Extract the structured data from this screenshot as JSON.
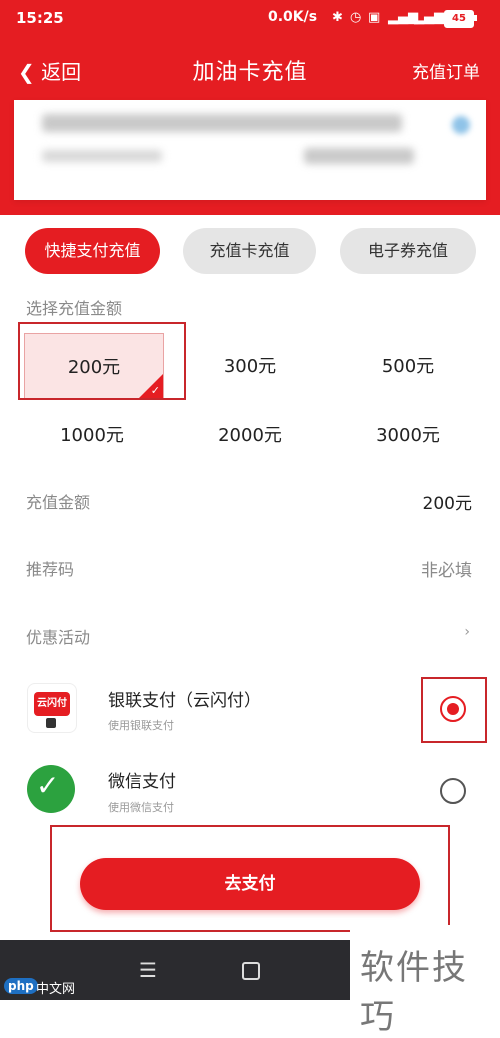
{
  "status_bar": {
    "time": "15:25",
    "net_speed": "0.0K/s",
    "battery": "45"
  },
  "nav": {
    "back": "返回",
    "title": "加油卡充值",
    "orders": "充值订单"
  },
  "tabs": [
    "快捷支付充值",
    "充值卡充值",
    "电子券充值"
  ],
  "amount": {
    "section_label": "选择充值金额",
    "options": [
      "200元",
      "300元",
      "500元",
      "1000元",
      "2000元",
      "3000元"
    ],
    "selected": "200元"
  },
  "rows": {
    "recharge_amount_label": "充值金额",
    "recharge_amount_value": "200元",
    "referral_label": "推荐码",
    "referral_placeholder": "非必填",
    "promo_label": "优惠活动",
    "promo_arrow": "›"
  },
  "payments": [
    {
      "title": "银联支付（云闪付）",
      "sub": "使用银联支付",
      "selected": true
    },
    {
      "title": "微信支付",
      "sub": "使用微信支付",
      "selected": false
    }
  ],
  "icons": {
    "ysf_text": "云闪付"
  },
  "pay_button": "去支付",
  "bottom_nav": {
    "menu": "☰"
  },
  "watermark": {
    "text": "软件技巧",
    "php": "php",
    "site": "中文网"
  },
  "colors": {
    "brand": "#e51d22"
  }
}
